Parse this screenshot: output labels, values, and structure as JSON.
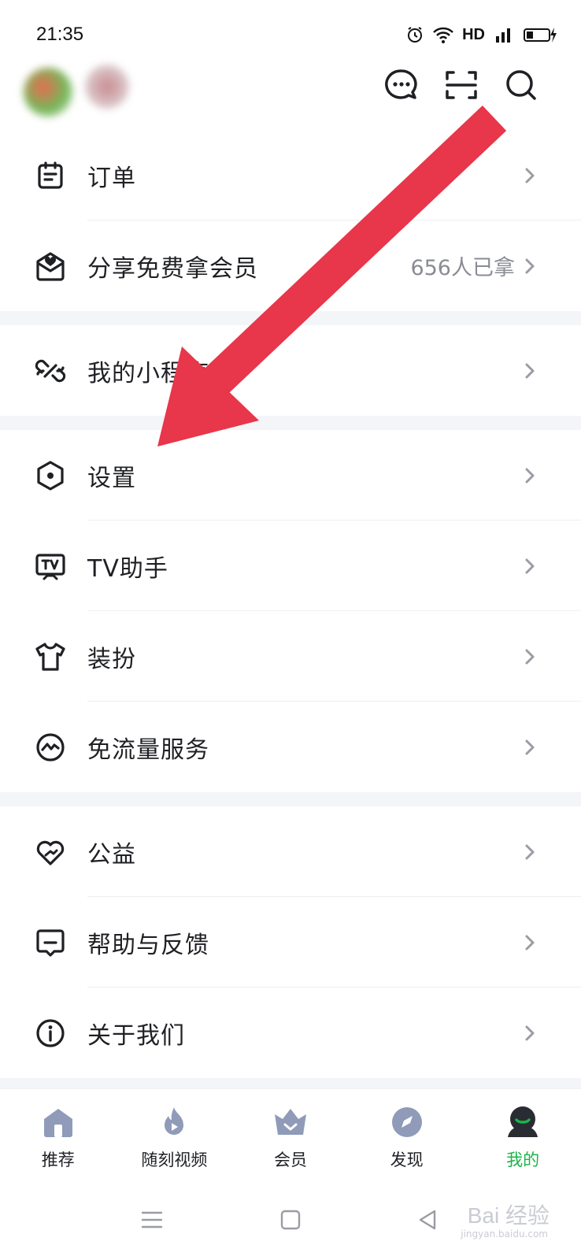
{
  "status_bar": {
    "time": "21:35",
    "network": "HD"
  },
  "header": {
    "actions": [
      "message-icon",
      "scan-icon",
      "search-icon"
    ]
  },
  "menu": {
    "orders": {
      "label": "订单"
    },
    "share": {
      "label": "分享免费拿会员",
      "extra": "656人已拿"
    },
    "mini_programs": {
      "label": "我的小程序"
    },
    "settings": {
      "label": "设置"
    },
    "tv_helper": {
      "label": "TV助手"
    },
    "dress_up": {
      "label": "装扮"
    },
    "free_data": {
      "label": "免流量服务"
    },
    "charity": {
      "label": "公益"
    },
    "help": {
      "label": "帮助与反馈"
    },
    "about": {
      "label": "关于我们"
    }
  },
  "tabbar": {
    "recommend": {
      "label": "推荐"
    },
    "short_video": {
      "label": "随刻视频"
    },
    "vip": {
      "label": "会员"
    },
    "discover": {
      "label": "发现"
    },
    "mine": {
      "label": "我的"
    }
  },
  "colors": {
    "accent_green": "#1bb449",
    "annotation_arrow": "#e8364a",
    "tab_icon_gray": "#8f9bb8",
    "section_gap": "#f4f5f9"
  },
  "watermark": {
    "text": "Bai 经验",
    "sub": "jingyan.baidu.com"
  }
}
